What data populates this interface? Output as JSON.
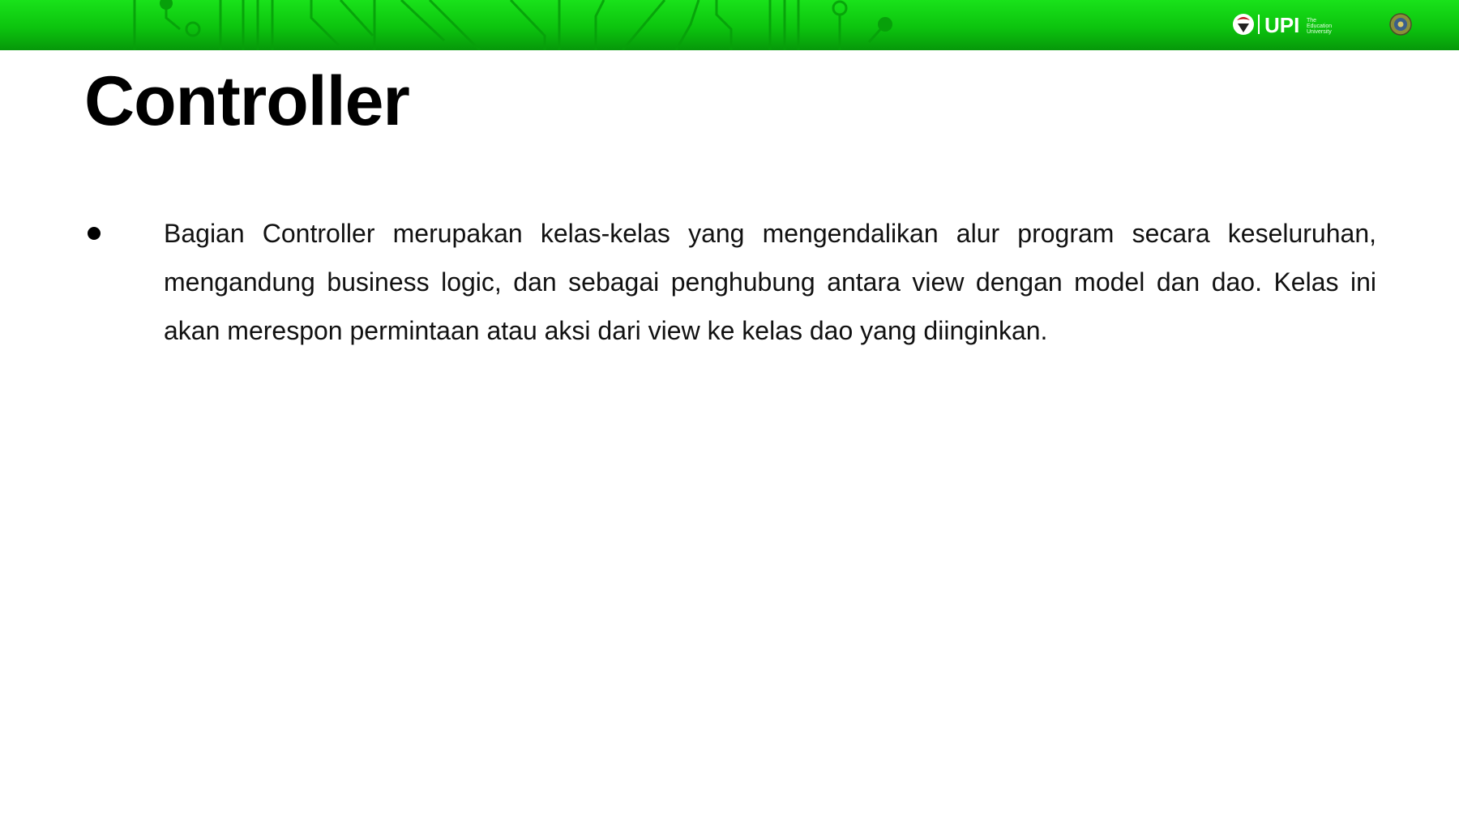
{
  "header": {
    "logo_text": "UPI",
    "logo_tagline": "The Education University"
  },
  "slide": {
    "title": "Controller",
    "bullets": [
      "Bagian Controller merupakan kelas-kelas yang mengendalikan alur program secara keseluruhan, mengandung business logic, dan sebagai penghubung antara view dengan model dan dao. Kelas ini akan merespon permintaan atau aksi dari view ke kelas dao yang diinginkan."
    ]
  },
  "colors": {
    "header_green": "#0cc40e",
    "header_dark_green": "#06980a",
    "text": "#000000"
  },
  "icons": [
    "circuit-pattern",
    "upi-logo-icon",
    "university-seal-icon"
  ]
}
